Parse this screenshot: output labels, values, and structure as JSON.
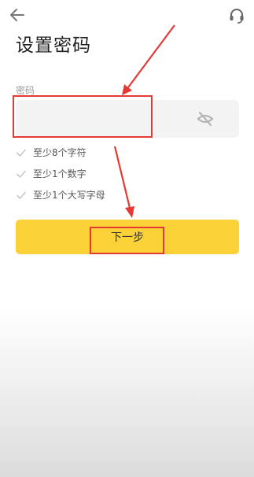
{
  "header": {
    "back_icon": "arrow-left-icon",
    "support_icon": "headset-icon"
  },
  "page": {
    "title": "设置密码"
  },
  "password_field": {
    "label": "密码",
    "value": "",
    "placeholder": "",
    "visibility_icon": "eye-off-icon"
  },
  "rules": [
    {
      "text": "至少8个字符",
      "icon": "check-icon"
    },
    {
      "text": "至少1个数字",
      "icon": "check-icon"
    },
    {
      "text": "至少1个大写字母",
      "icon": "check-icon"
    }
  ],
  "actions": {
    "next_label": "下一步"
  },
  "colors": {
    "accent": "#fad238",
    "annotation": "#e53935",
    "input_bg": "#f3f3f3",
    "check": "#c8c8c8"
  }
}
